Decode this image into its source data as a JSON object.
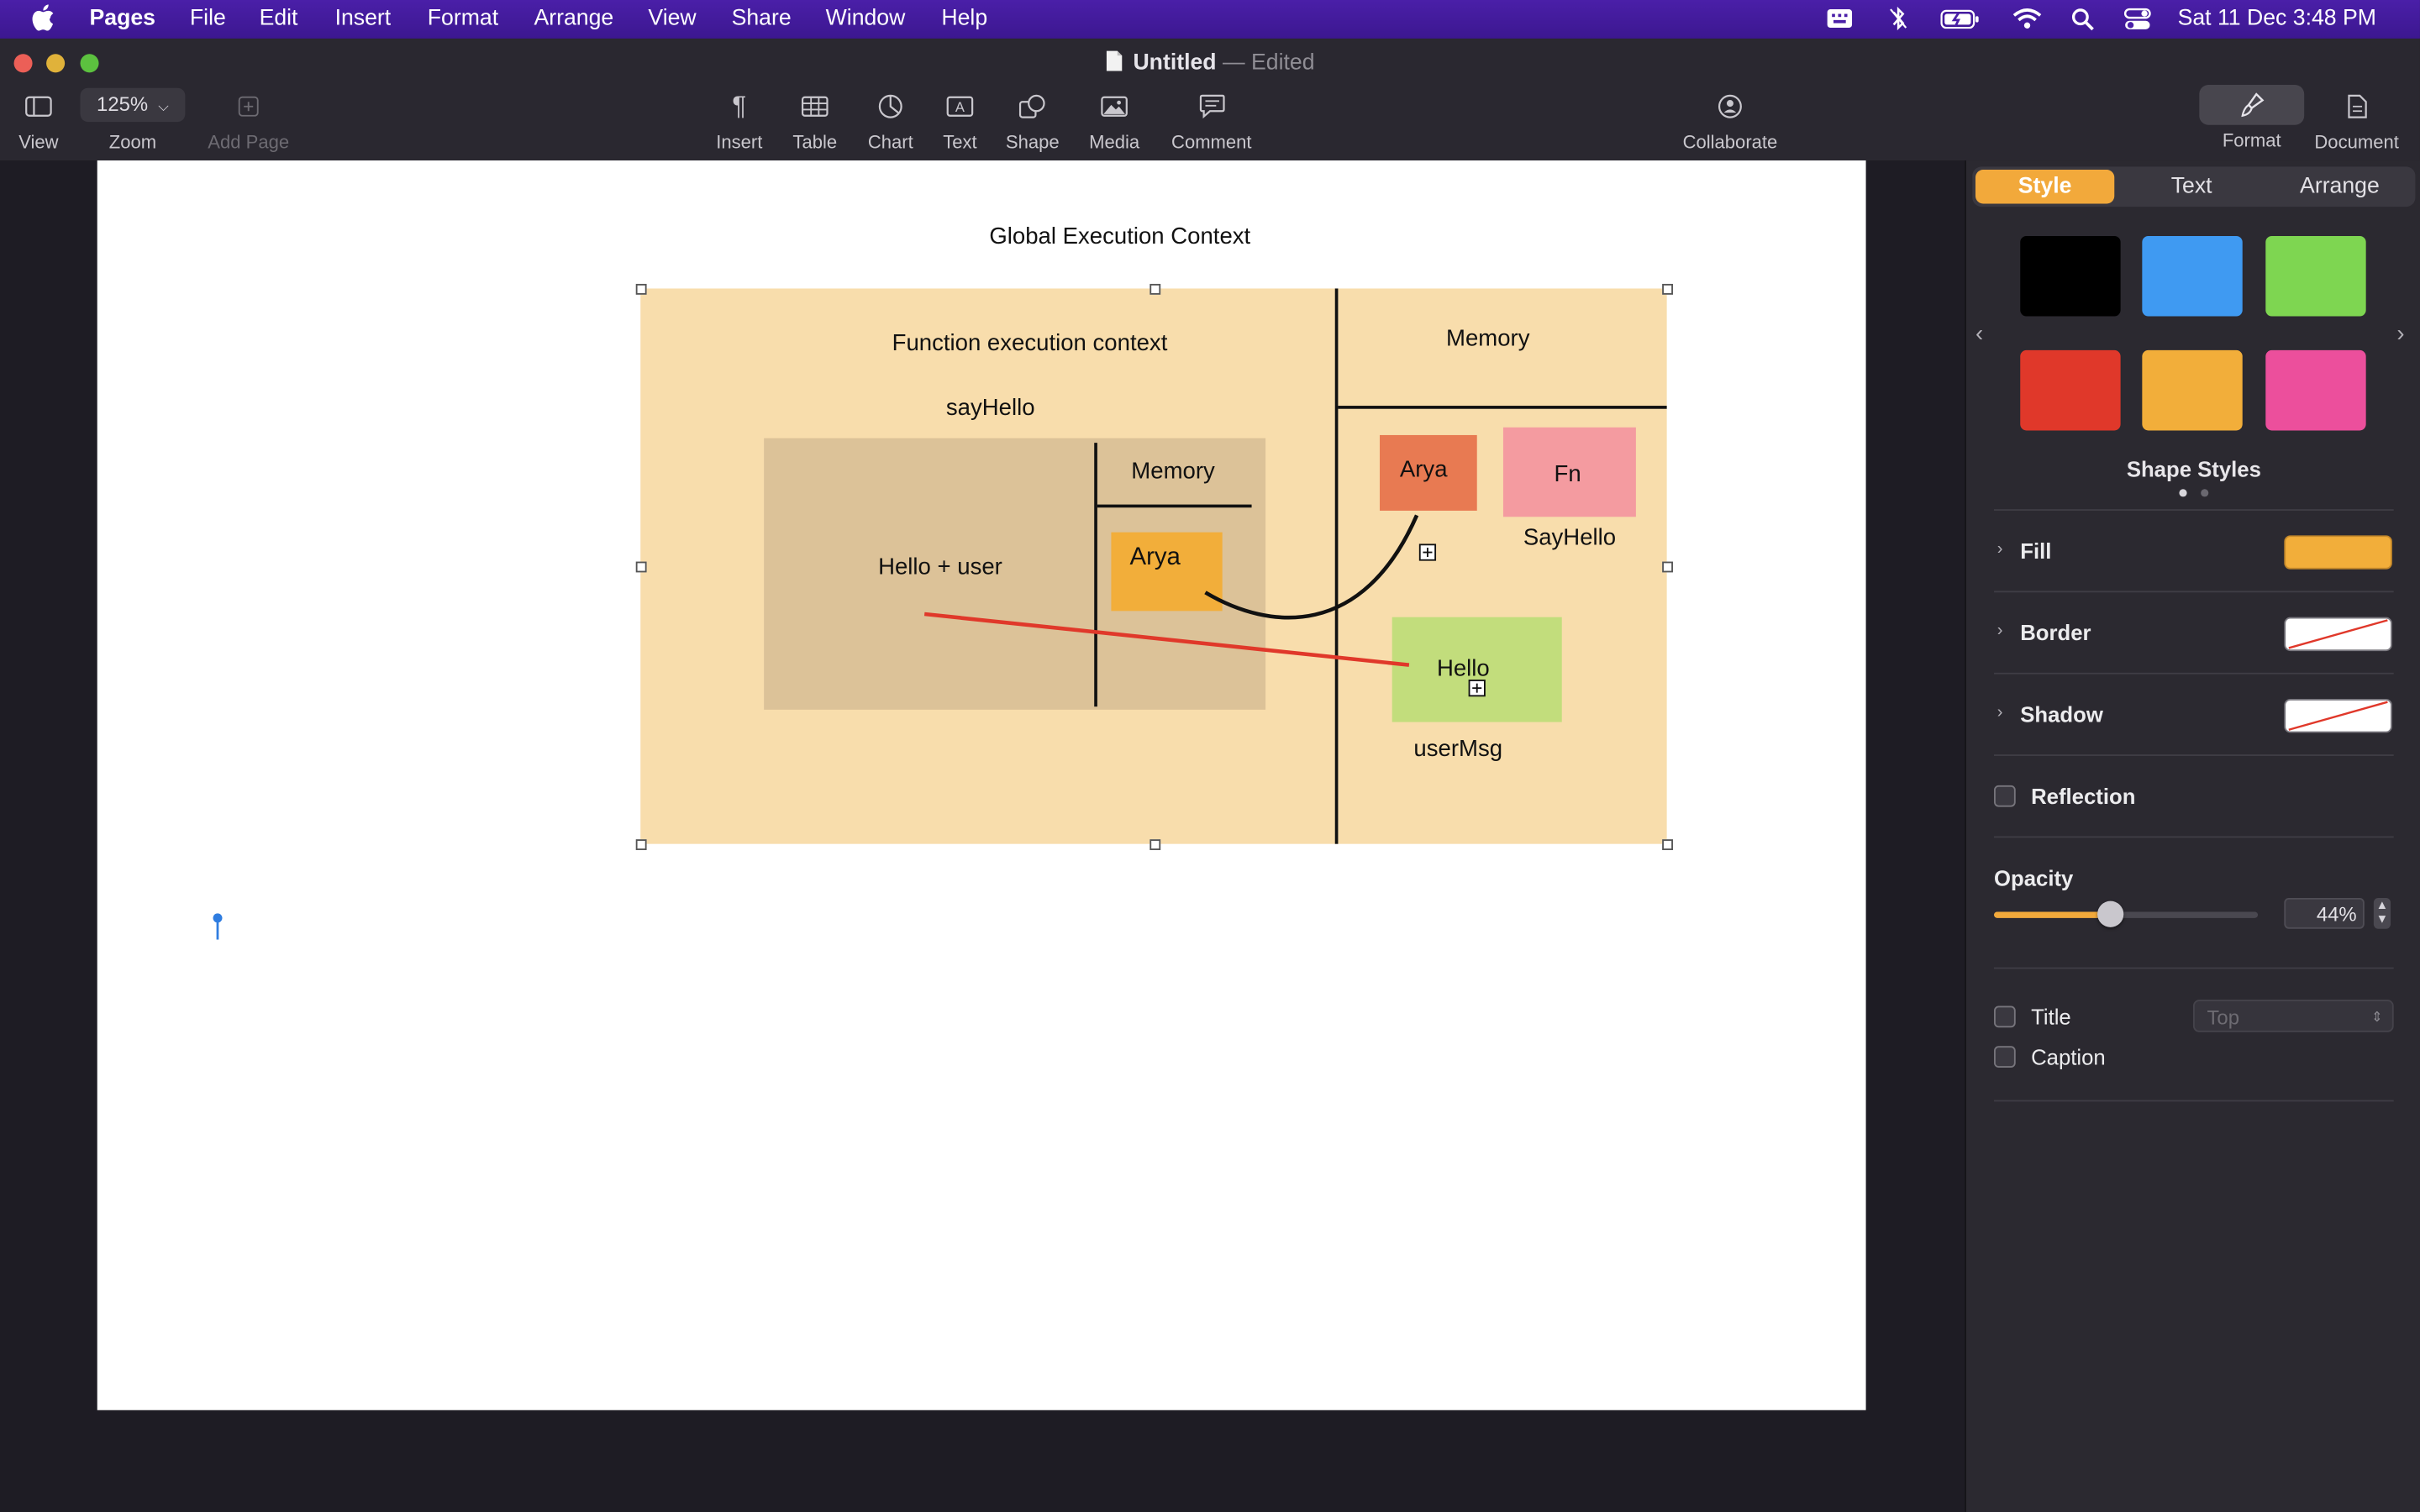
{
  "menubar": {
    "apple": "",
    "app": "Pages",
    "items": [
      "File",
      "Edit",
      "Insert",
      "Format",
      "Arrange",
      "View",
      "Share",
      "Window",
      "Help"
    ],
    "clock": "Sat 11 Dec  3:48 PM"
  },
  "window": {
    "title": "Untitled",
    "separator": "—",
    "status": "Edited"
  },
  "toolbar": {
    "view": "View",
    "zoom_value": "125%",
    "zoom": "Zoom",
    "add_page": "Add Page",
    "insert": "Insert",
    "table": "Table",
    "chart": "Chart",
    "text": "Text",
    "shape": "Shape",
    "media": "Media",
    "comment": "Comment",
    "collaborate": "Collaborate",
    "format": "Format",
    "document": "Document"
  },
  "diagram": {
    "title": "Global Execution Context",
    "function_context": "Function execution context",
    "function_name": "sayHello",
    "inner_memory": "Memory",
    "body_expr": "Hello + user",
    "inner_value": "Arya",
    "global_memory": "Memory",
    "global_arya": "Arya",
    "fn_box": "Fn",
    "fn_name": "SayHello",
    "hello_box": "Hello",
    "hello_name": "userMsg"
  },
  "inspector": {
    "tabs": [
      "Style",
      "Text",
      "Arrange"
    ],
    "shape_styles": "Shape Styles",
    "fill": "Fill",
    "border": "Border",
    "shadow": "Shadow",
    "reflection": "Reflection",
    "opacity": "Opacity",
    "opacity_value": "44%",
    "opacity_fraction": 0.44,
    "title": "Title",
    "title_position": "Top",
    "caption": "Caption"
  },
  "colors": {
    "menubar": "#4a1fa8",
    "accent": "#f2a93b",
    "swatches": [
      "#000000",
      "#3f9af2",
      "#7ed651",
      "#e0382a",
      "#f2ae3a",
      "#ec4f9c"
    ]
  }
}
